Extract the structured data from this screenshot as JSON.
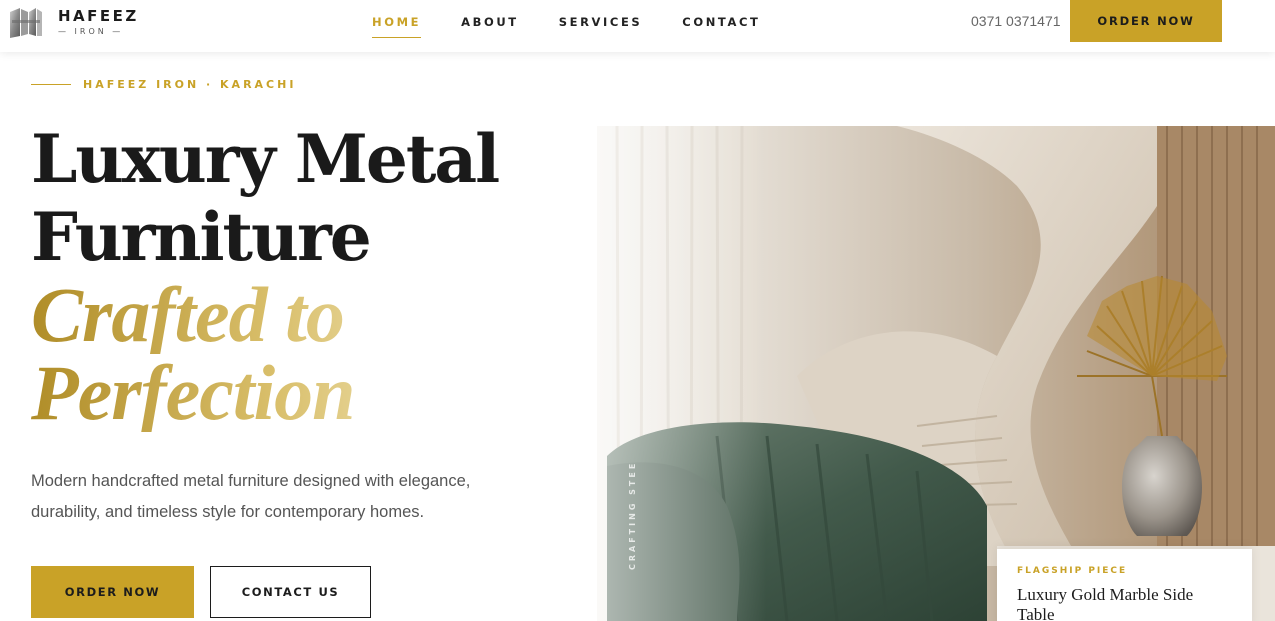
{
  "brand": {
    "name": "HAFEEZ",
    "sub": "— IRON —",
    "logo_icon": "building-columns-icon"
  },
  "nav": {
    "items": [
      {
        "label": "HOME",
        "active": true
      },
      {
        "label": "ABOUT",
        "active": false
      },
      {
        "label": "SERVICES",
        "active": false
      },
      {
        "label": "CONTACT",
        "active": false
      }
    ]
  },
  "header": {
    "phone": "0371 0371471",
    "order_label": "ORDER NOW"
  },
  "hero": {
    "eyebrow": "HAFEEZ IRON · KARACHI",
    "headline_line1": "Luxury Metal",
    "headline_line2": "Furniture",
    "headline_gold1": "Crafted to",
    "headline_gold2": "Perfection",
    "lede": "Modern handcrafted metal furniture designed with elegance, durability, and timeless style for contemporary homes.",
    "order_label": "ORDER NOW",
    "contact_label": "CONTACT US",
    "vertical_text": "CRAFTING STEE"
  },
  "feature": {
    "tag": "FLAGSHIP PIECE",
    "title": "Luxury Gold Marble Side Table"
  },
  "colors": {
    "accent": "#c9a227",
    "text_dark": "#1c1c1c",
    "text_muted": "#555555",
    "chair_green": "#3f5548"
  }
}
